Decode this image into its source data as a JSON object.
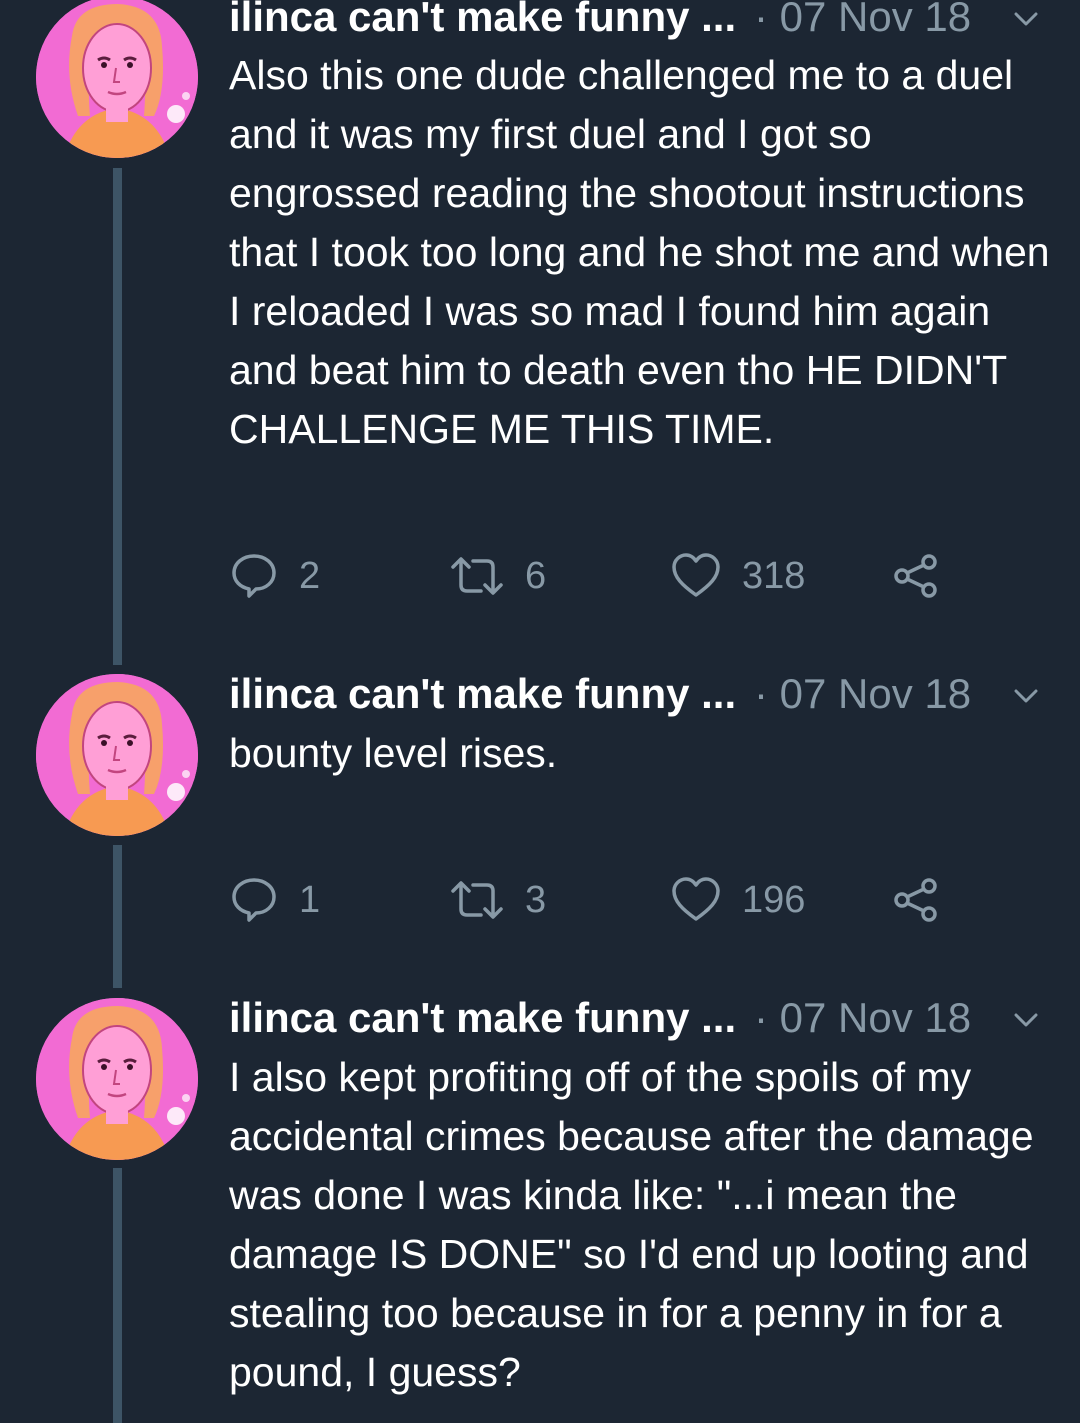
{
  "tweets": [
    {
      "author": "ilinca can't make funny ...",
      "date": "· 07 Nov 18",
      "text": "Also this one dude challenged me to a duel and it was my first duel and I got so engrossed reading the shootout instructions that I took too long and he shot me and when I reloaded I was so mad I found him again and beat him to death even tho HE DIDN'T CHALLENGE ME THIS TIME.",
      "replies": "2",
      "retweets": "6",
      "likes": "318"
    },
    {
      "author": "ilinca can't make funny ...",
      "date": "· 07 Nov 18",
      "text": "bounty level rises.",
      "replies": "1",
      "retweets": "3",
      "likes": "196"
    },
    {
      "author": "ilinca can't make funny ...",
      "date": "· 07 Nov 18",
      "text": "I also kept profiting off of the spoils of my accidental crimes because after the damage was done I was kinda like: \"...i mean the damage IS DONE\" so I'd end up looting and stealing too because in for a penny in for a pound, I guess?"
    }
  ],
  "icons": {
    "reply": "reply-icon",
    "retweet": "retweet-icon",
    "like": "heart-icon",
    "share": "share-icon",
    "menu": "chevron-down-icon"
  },
  "colors": {
    "background": "#1c2633",
    "text": "#ffffff",
    "secondary_text": "#8899a6",
    "thread_line": "#3d5466",
    "avatar_bg": "#f26bd3"
  }
}
